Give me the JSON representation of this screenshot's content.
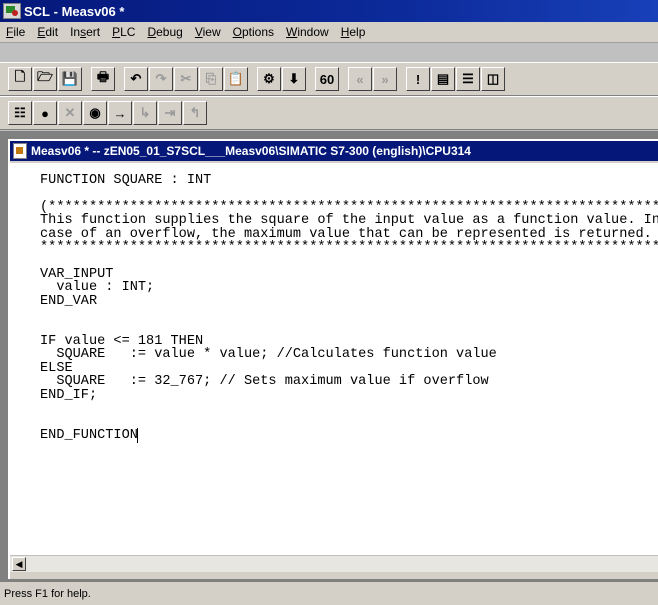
{
  "window": {
    "app": "SCL",
    "separator": " - ",
    "document": "Measv06 *"
  },
  "menu": [
    {
      "accel": "F",
      "rest": "ile"
    },
    {
      "accel": "E",
      "rest": "dit"
    },
    {
      "pre": "In",
      "accel": "s",
      "rest": "ert"
    },
    {
      "accel": "P",
      "rest": "LC"
    },
    {
      "accel": "D",
      "rest": "ebug"
    },
    {
      "accel": "V",
      "rest": "iew"
    },
    {
      "accel": "O",
      "rest": "ptions"
    },
    {
      "accel": "W",
      "rest": "indow"
    },
    {
      "accel": "H",
      "rest": "elp"
    }
  ],
  "toolbar_main": [
    {
      "icon": "new-file-icon",
      "glyph": "🗋"
    },
    {
      "icon": "open-folder-icon",
      "glyph": "🗁"
    },
    {
      "icon": "save-icon",
      "glyph": "💾"
    },
    {
      "icon": "sep"
    },
    {
      "icon": "print-icon",
      "glyph": "🖶"
    },
    {
      "icon": "sep"
    },
    {
      "icon": "undo-icon",
      "glyph": "↶"
    },
    {
      "icon": "redo-icon",
      "glyph": "↷",
      "dim": true
    },
    {
      "icon": "cut-icon",
      "glyph": "✂",
      "dim": true
    },
    {
      "icon": "copy-icon",
      "glyph": "⎘",
      "dim": true
    },
    {
      "icon": "paste-icon",
      "glyph": "📋"
    },
    {
      "icon": "sep"
    },
    {
      "icon": "compile-icon",
      "glyph": "⚙"
    },
    {
      "icon": "download-icon",
      "glyph": "⬇"
    },
    {
      "icon": "sep"
    },
    {
      "icon": "monitor-icon",
      "glyph": "60"
    },
    {
      "icon": "sep"
    },
    {
      "icon": "step-back-icon",
      "glyph": "«",
      "dim": true
    },
    {
      "icon": "step-forward-icon",
      "glyph": "»",
      "dim": true
    },
    {
      "icon": "sep"
    },
    {
      "icon": "breakpoint-icon",
      "glyph": "!"
    },
    {
      "icon": "window-tile-icon",
      "glyph": "▤"
    },
    {
      "icon": "window-horizontal-icon",
      "glyph": "☰"
    },
    {
      "icon": "window-vertical-icon",
      "glyph": "◫"
    }
  ],
  "toolbar_debug": [
    {
      "icon": "list-icon",
      "glyph": "☷"
    },
    {
      "icon": "breakpoint-set-icon",
      "glyph": "●"
    },
    {
      "icon": "breakpoint-delete-icon",
      "glyph": "✕",
      "dim": true
    },
    {
      "icon": "breakpoint-enable-icon",
      "glyph": "◉"
    },
    {
      "icon": "run-to-breakpoint-icon",
      "glyph": "→"
    },
    {
      "icon": "step-into-icon",
      "glyph": "↳",
      "dim": true
    },
    {
      "icon": "step-over-icon",
      "glyph": "⇥",
      "dim": true
    },
    {
      "icon": "step-out-icon",
      "glyph": "↰",
      "dim": true
    }
  ],
  "editor": {
    "title": "Measv06 * -- zEN05_01_S7SCL___Measv06\\SIMATIC S7-300 (english)\\CPU314",
    "code_lines": [
      "FUNCTION SQUARE : INT",
      "",
      "(****************************************************************************",
      "This function supplies the square of the input value as a function value. In",
      "case of an overflow, the maximum value that can be represented is returned.",
      "*****************************************************************************)",
      "",
      "VAR_INPUT",
      "  value : INT;",
      "END_VAR",
      "",
      "",
      "IF value <= 181 THEN",
      "  SQUARE   := value * value; //Calculates function value",
      "ELSE",
      "  SQUARE   := 32_767; // Sets maximum value if overflow",
      "END_IF;",
      "",
      "",
      "END_FUNCTION"
    ]
  },
  "status": {
    "text": "Press F1 for help."
  },
  "colors": {
    "title_bar": "#05187a",
    "chrome": "#d4d0c8",
    "mdi_background": "#808080"
  }
}
